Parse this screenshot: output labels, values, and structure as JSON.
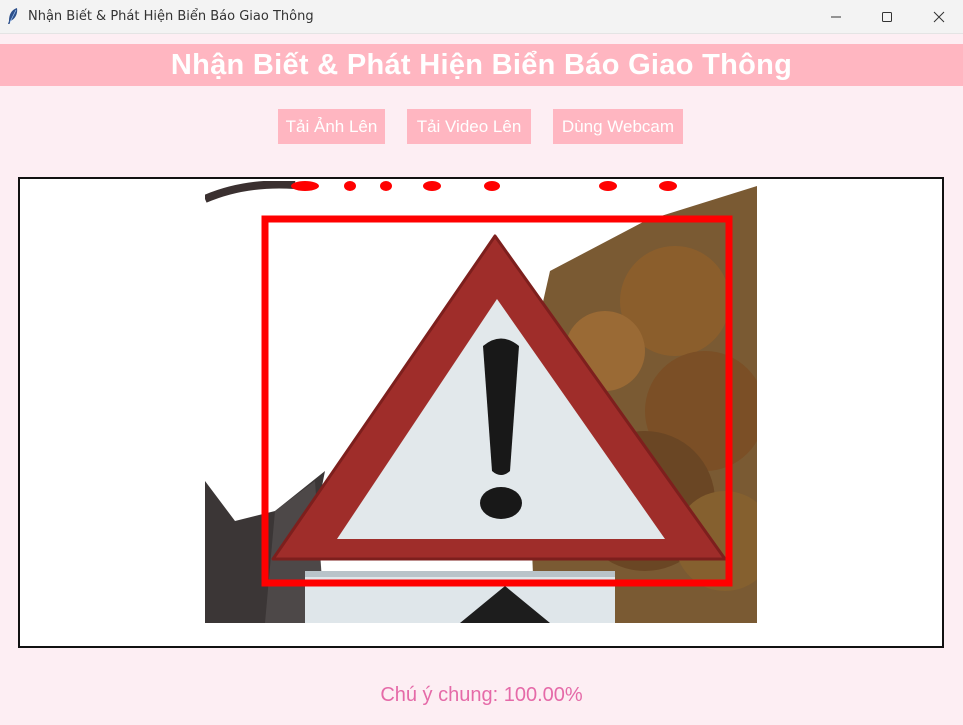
{
  "window": {
    "title": "Nhận Biết & Phát Hiện Biển Báo Giao Thông",
    "app_icon": "feather-icon",
    "controls": [
      "minimize-icon",
      "maximize-icon",
      "close-icon"
    ]
  },
  "header": {
    "title": "Nhận Biết & Phát Hiện Biển Báo Giao Thông"
  },
  "toolbar": {
    "upload_image_label": "Tải Ảnh Lên",
    "upload_video_label": "Tải Video Lên",
    "webcam_label": "Dùng Webcam"
  },
  "display": {
    "image_content": "warning-triangle-sign-with-exclamation",
    "detection_box_color": "#ff0000"
  },
  "status": {
    "text": "Chú ý chung: 100.00%"
  },
  "colors": {
    "background": "#fdeef3",
    "accent": "#ffb6c1",
    "status_text": "#e56aa8"
  }
}
